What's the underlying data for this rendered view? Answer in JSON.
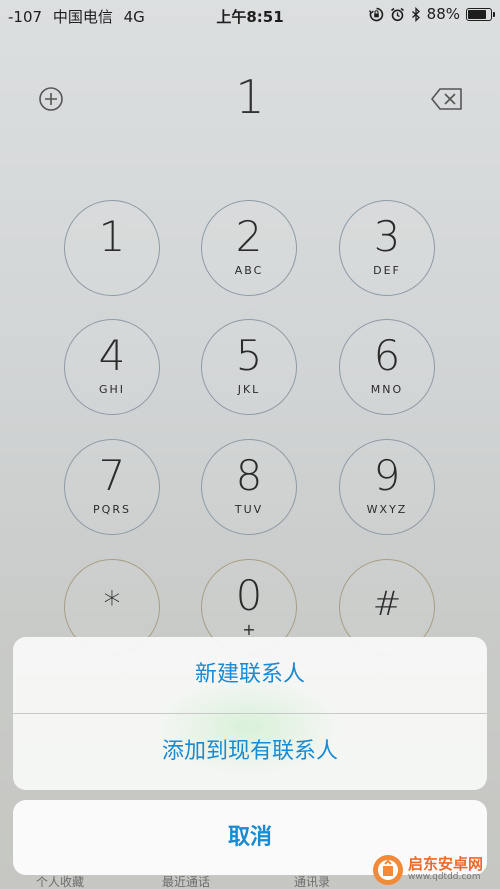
{
  "status_bar": {
    "signal": "-107",
    "carrier": "中国电信",
    "network": "4G",
    "time": "上午8:51",
    "battery": "88%",
    "battery_level": 0.88,
    "icons": [
      "rotation-lock-icon",
      "alarm-icon",
      "bluetooth-icon",
      "battery-icon"
    ]
  },
  "dialer": {
    "number": "1",
    "add_icon": "plus-circle-icon",
    "delete_icon": "backspace-icon",
    "keys": [
      {
        "digit": "1",
        "letters": ""
      },
      {
        "digit": "2",
        "letters": "ABC"
      },
      {
        "digit": "3",
        "letters": "DEF"
      },
      {
        "digit": "4",
        "letters": "GHI"
      },
      {
        "digit": "5",
        "letters": "JKL"
      },
      {
        "digit": "6",
        "letters": "MNO"
      },
      {
        "digit": "7",
        "letters": "PQRS"
      },
      {
        "digit": "8",
        "letters": "TUV"
      },
      {
        "digit": "9",
        "letters": "WXYZ"
      },
      {
        "digit": "*",
        "letters": ""
      },
      {
        "digit": "0",
        "letters": "+"
      },
      {
        "digit": "#",
        "letters": ""
      }
    ]
  },
  "action_sheet": {
    "new_contact": "新建联系人",
    "add_to_existing": "添加到现有联系人",
    "cancel": "取消"
  },
  "tab_bar": {
    "tabs": [
      "个人收藏",
      "最近通话",
      "通讯录"
    ]
  },
  "watermark": {
    "title": "启东安卓网",
    "url": "www.qdtdd.com"
  },
  "colors": {
    "accent": "#1a8ad2",
    "key_border": "#8f9ba6",
    "watermark": "#ec6a2c"
  }
}
